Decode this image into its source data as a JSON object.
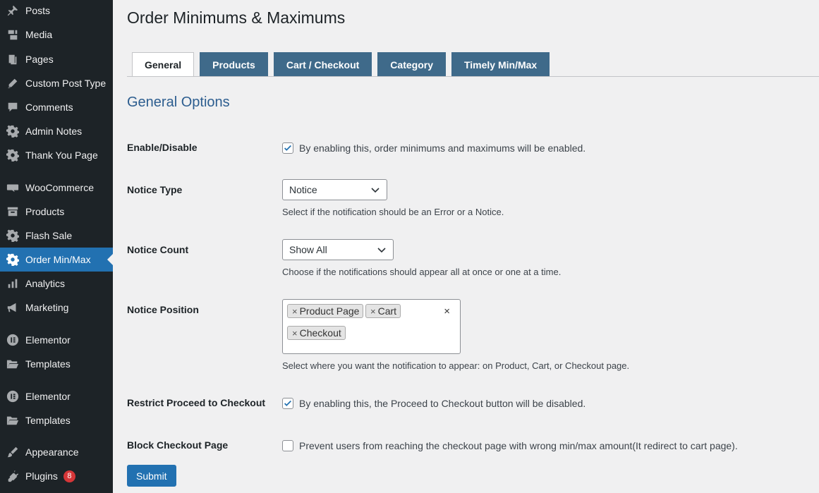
{
  "sidebar": {
    "items": [
      {
        "label": "Posts",
        "icon": "pin-icon"
      },
      {
        "label": "Media",
        "icon": "media-icon"
      },
      {
        "label": "Pages",
        "icon": "pages-icon"
      },
      {
        "label": "Custom Post Type",
        "icon": "pencil-icon"
      },
      {
        "label": "Comments",
        "icon": "comment-icon"
      },
      {
        "label": "Admin Notes",
        "icon": "gear-icon"
      },
      {
        "label": "Thank You Page",
        "icon": "gear-icon"
      },
      {
        "label": "WooCommerce",
        "icon": "woo-icon"
      },
      {
        "label": "Products",
        "icon": "archive-icon"
      },
      {
        "label": "Flash Sale",
        "icon": "gear-icon"
      },
      {
        "label": "Order Min/Max",
        "icon": "gear-icon"
      },
      {
        "label": "Analytics",
        "icon": "bar-chart-icon"
      },
      {
        "label": "Marketing",
        "icon": "megaphone-icon"
      },
      {
        "label": "Elementor",
        "icon": "elementor-icon"
      },
      {
        "label": "Templates",
        "icon": "folder-icon"
      },
      {
        "label": "Elementor",
        "icon": "elementor-icon"
      },
      {
        "label": "Templates",
        "icon": "folder-icon"
      },
      {
        "label": "Appearance",
        "icon": "brush-icon"
      },
      {
        "label": "Plugins",
        "icon": "plug-icon",
        "badge": "8"
      }
    ]
  },
  "page": {
    "title": "Order Minimums & Maximums",
    "tabs": [
      "General",
      "Products",
      "Cart / Checkout",
      "Category",
      "Timely Min/Max"
    ],
    "active_tab": "General",
    "section_title": "General Options"
  },
  "form": {
    "enable": {
      "label": "Enable/Disable",
      "checked": true,
      "text": "By enabling this, order minimums and maximums will be enabled."
    },
    "notice_type": {
      "label": "Notice Type",
      "value": "Notice",
      "desc": "Select if the notification should be an Error or a Notice."
    },
    "notice_count": {
      "label": "Notice Count",
      "value": "Show All",
      "desc": "Choose if the notifications should appear all at once or one at a time."
    },
    "notice_position": {
      "label": "Notice Position",
      "chips": [
        "Product Page",
        "Cart",
        "Checkout"
      ],
      "chip_remove": "×",
      "clear": "×",
      "desc": "Select where you want the notification to appear: on Product, Cart, or Checkout page."
    },
    "restrict": {
      "label": "Restrict Proceed to Checkout",
      "checked": true,
      "text": "By enabling this, the Proceed to Checkout button will be disabled."
    },
    "block": {
      "label": "Block Checkout Page",
      "checked": false,
      "text": "Prevent users from reaching the checkout page with wrong min/max amount(It redirect to cart page)."
    },
    "submit_label": "Submit"
  },
  "colors": {
    "sidebar_bg": "#1d2327",
    "active_menu": "#2271b1",
    "tab_bg": "#3f6a8a",
    "section_title": "#2c5d8f",
    "badge": "#d63638"
  }
}
